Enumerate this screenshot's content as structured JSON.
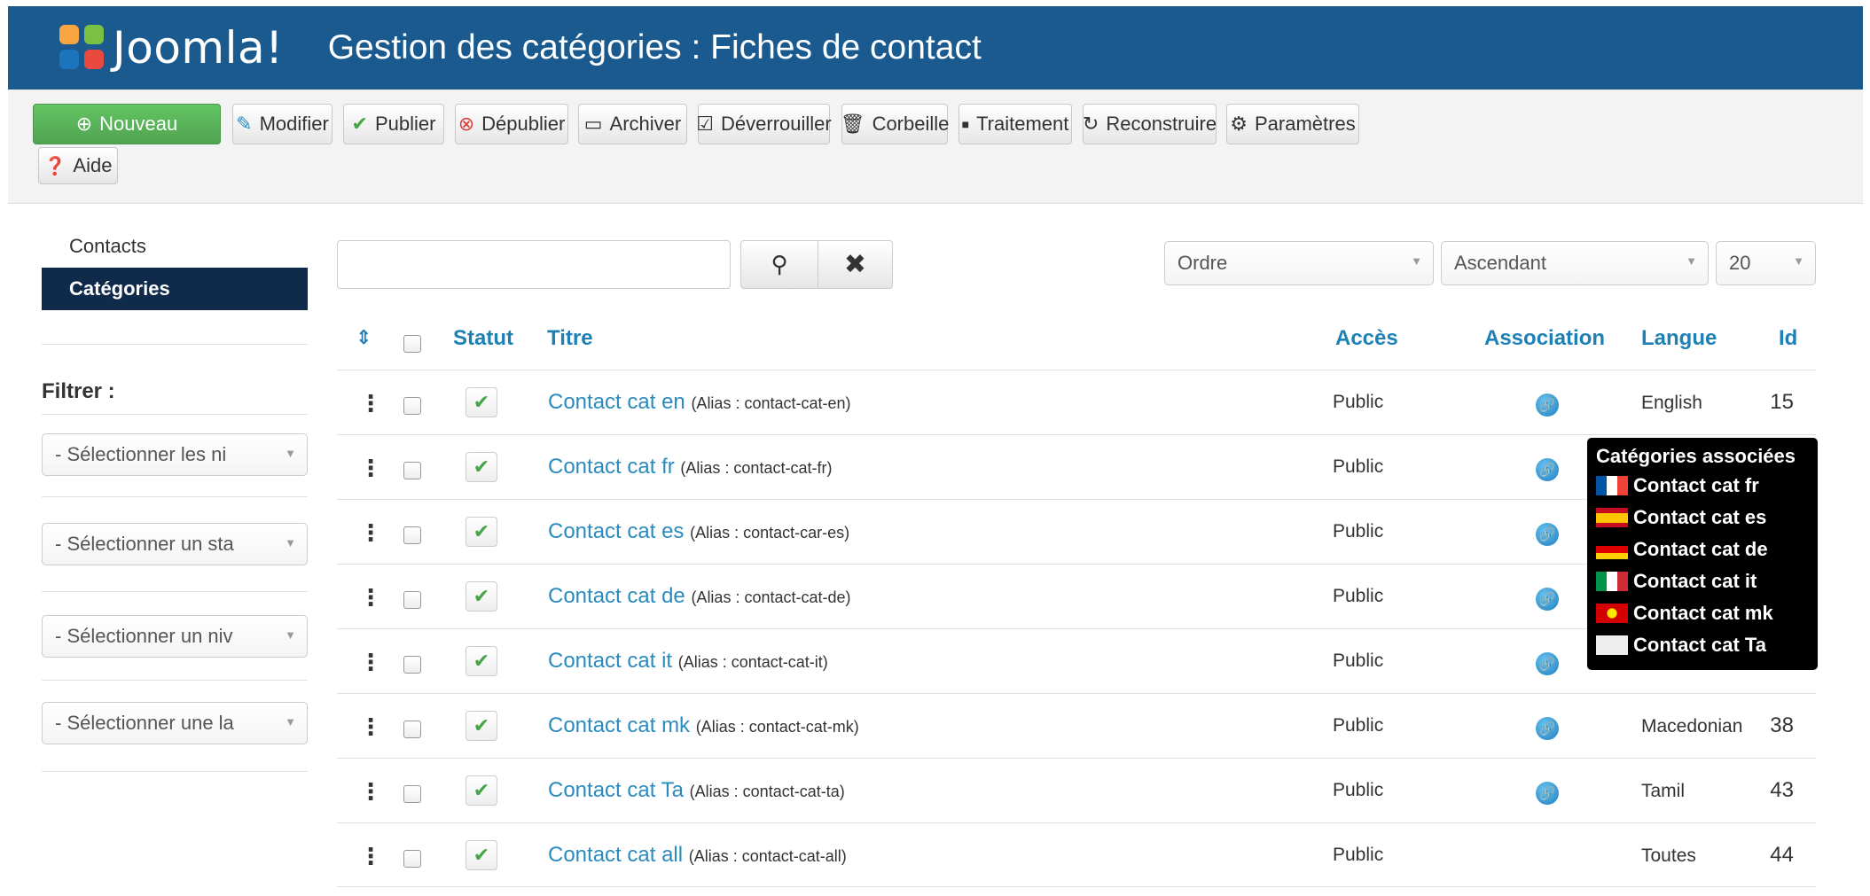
{
  "header": {
    "logo_text": "Joomla!",
    "page_title": "Gestion des catégories : Fiches de contact",
    "bg_color": "#1a5a8e"
  },
  "toolbar": {
    "buttons": [
      {
        "label": "Nouveau",
        "icon": "plus-circle-icon"
      },
      {
        "label": "Modifier",
        "icon": "edit-icon"
      },
      {
        "label": "Publier",
        "icon": "check-icon"
      },
      {
        "label": "Dépublier",
        "icon": "times-circle-icon"
      },
      {
        "label": "Archiver",
        "icon": "archive-icon"
      },
      {
        "label": "Déverrouiller",
        "icon": "checkbox-icon"
      },
      {
        "label": "Corbeille",
        "icon": "trash-icon"
      },
      {
        "label": "Traitement",
        "icon": "batch-icon"
      },
      {
        "label": "Reconstruire",
        "icon": "refresh-icon"
      },
      {
        "label": "Paramètres",
        "icon": "gear-icon"
      },
      {
        "label": "Aide",
        "icon": "question-circle-icon"
      }
    ]
  },
  "sidebar": {
    "items": [
      {
        "label": "Contacts",
        "active": false
      },
      {
        "label": "Catégories",
        "active": true
      }
    ],
    "filter_label": "Filtrer :",
    "filters": [
      "- Sélectionner les ni",
      "- Sélectionner un sta",
      "- Sélectionner un niv",
      "- Sélectionner une la"
    ]
  },
  "search": {
    "placeholder": "",
    "value": ""
  },
  "list_controls": {
    "ordering": "Ordre",
    "direction": "Ascendant",
    "limit": "20"
  },
  "table": {
    "headers": {
      "statut": "Statut",
      "titre": "Titre",
      "acces": "Accès",
      "association": "Association",
      "langue": "Langue",
      "id": "Id"
    },
    "rows": [
      {
        "title": "Contact cat en",
        "alias": "(Alias : contact-cat-en)",
        "access": "Public",
        "assoc": true,
        "language": "English",
        "id": "15"
      },
      {
        "title": "Contact cat fr",
        "alias": "(Alias : contact-cat-fr)",
        "access": "Public",
        "assoc": true,
        "language": "",
        "id": ""
      },
      {
        "title": "Contact cat es",
        "alias": "(Alias : contact-car-es)",
        "access": "Public",
        "assoc": true,
        "language": "",
        "id": ""
      },
      {
        "title": "Contact cat de",
        "alias": "(Alias : contact-cat-de)",
        "access": "Public",
        "assoc": true,
        "language": "",
        "id": ""
      },
      {
        "title": "Contact cat it",
        "alias": "(Alias : contact-cat-it)",
        "access": "Public",
        "assoc": true,
        "language": "",
        "id": ""
      },
      {
        "title": "Contact cat mk",
        "alias": "(Alias : contact-cat-mk)",
        "access": "Public",
        "assoc": true,
        "language": "Macedonian",
        "id": "38"
      },
      {
        "title": "Contact cat Ta",
        "alias": "(Alias : contact-cat-ta)",
        "access": "Public",
        "assoc": true,
        "language": "Tamil",
        "id": "43"
      },
      {
        "title": "Contact cat all",
        "alias": "(Alias : contact-cat-all)",
        "access": "Public",
        "assoc": false,
        "language": "Toutes",
        "id": "44"
      }
    ]
  },
  "tooltip": {
    "title": "Catégories associées",
    "items": [
      {
        "label": "Contact cat fr",
        "flag": "fr"
      },
      {
        "label": "Contact cat es",
        "flag": "es"
      },
      {
        "label": "Contact cat de",
        "flag": "de"
      },
      {
        "label": "Contact cat it",
        "flag": "it"
      },
      {
        "label": "Contact cat mk",
        "flag": "mk"
      },
      {
        "label": "Contact cat Ta",
        "flag": "ta"
      }
    ]
  }
}
